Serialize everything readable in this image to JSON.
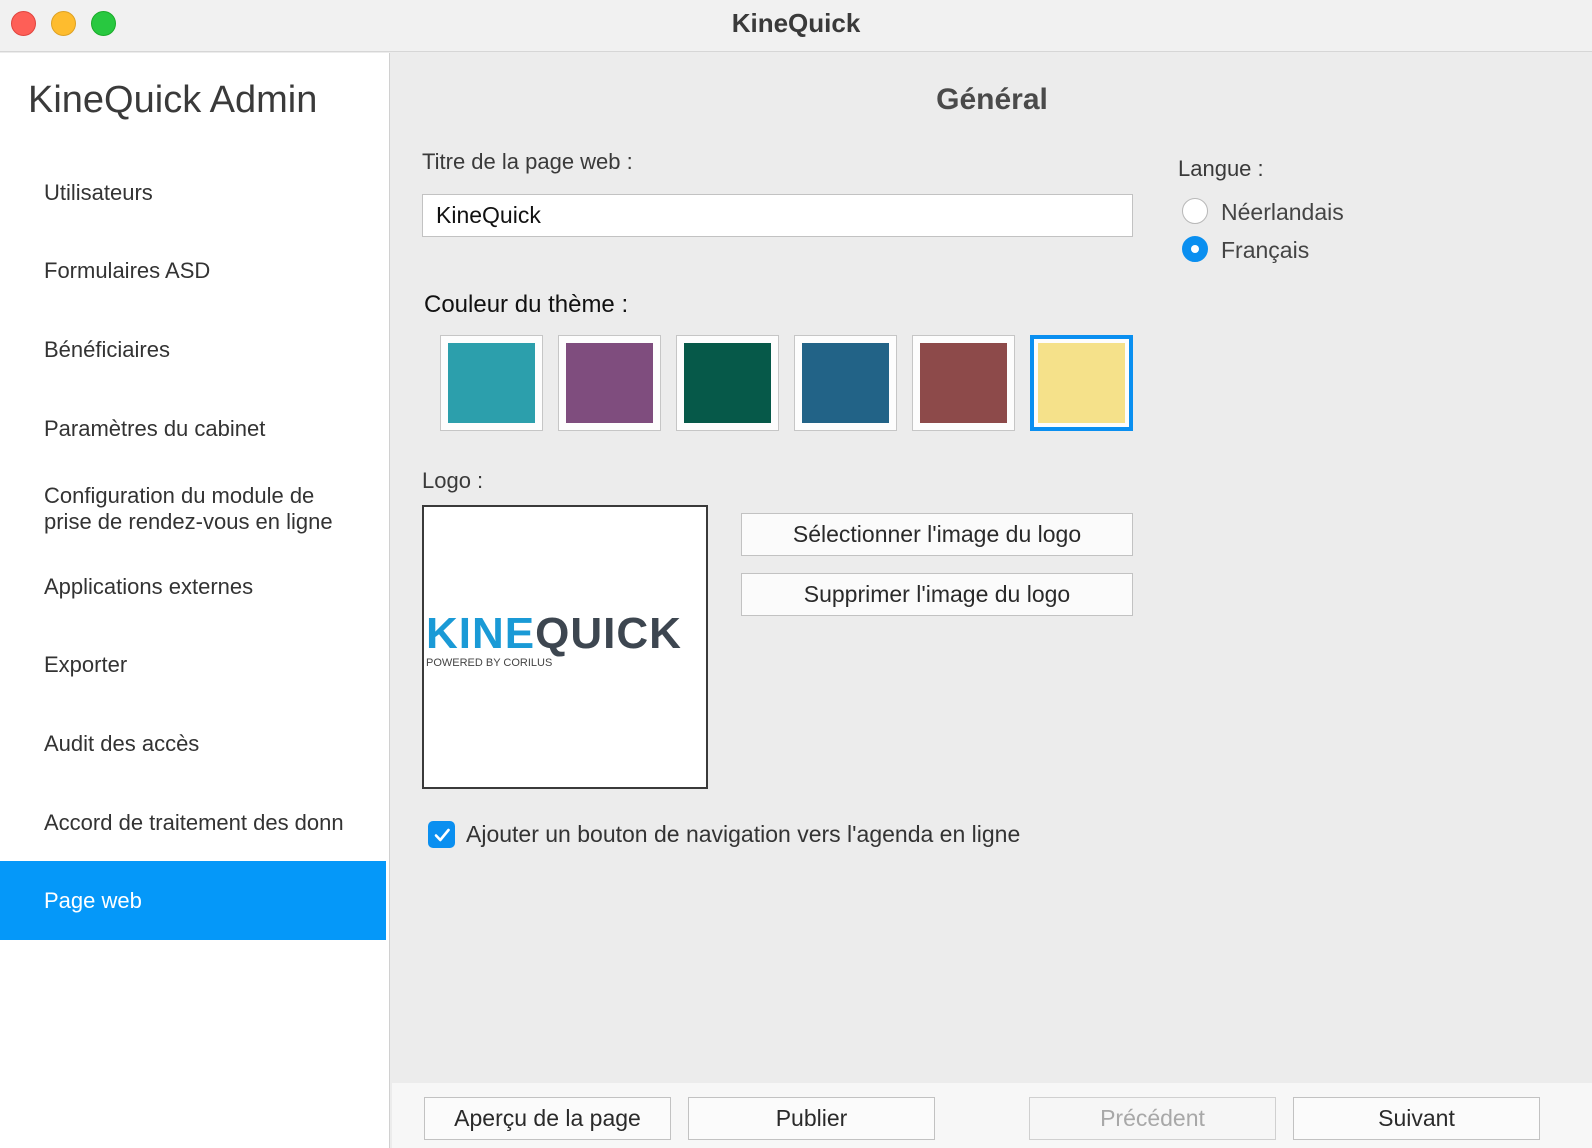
{
  "window": {
    "title": "KineQuick"
  },
  "sidebar": {
    "title": "KineQuick Admin",
    "items": [
      {
        "label": "Utilisateurs"
      },
      {
        "label": "Formulaires ASD"
      },
      {
        "label": "Bénéficiaires"
      },
      {
        "label": "Paramètres du cabinet"
      },
      {
        "label": "Configuration du module de\nprise de rendez-vous en ligne"
      },
      {
        "label": "Applications externes"
      },
      {
        "label": "Exporter"
      },
      {
        "label": "Audit des accès"
      },
      {
        "label": "Accord de traitement des donn"
      },
      {
        "label": "Page web"
      }
    ],
    "selected_item": "Page web"
  },
  "main": {
    "section_title": "Général",
    "title_field": {
      "label": "Titre de la page web :",
      "value": "KineQuick"
    },
    "theme": {
      "label": "Couleur du thème :",
      "colors": [
        "#2c9fac",
        "#7f4d7e",
        "#065949",
        "#226387",
        "#8d4a4a",
        "#f5e18a"
      ],
      "selected_index": 5
    },
    "logo": {
      "label": "Logo :",
      "brand_part1": "KINE",
      "brand_part2": "QUICK",
      "brand_sub": "POWERED BY CORILUS",
      "select_button": "Sélectionner l'image du logo",
      "delete_button": "Supprimer l'image du logo"
    },
    "agenda_checkbox": {
      "label": "Ajouter un bouton de navigation vers l'agenda en ligne",
      "checked": true
    },
    "language": {
      "label": "Langue :",
      "options": [
        "Néerlandais",
        "Français"
      ],
      "selected": "Français"
    }
  },
  "footer": {
    "preview_button": "Aperçu de la page",
    "publish_button": "Publier",
    "previous_button": "Précédent",
    "next_button": "Suivant"
  },
  "colors": {
    "accent": "#0598f9",
    "sidebar_bg": "#ffffff",
    "content_bg": "#ececec"
  }
}
